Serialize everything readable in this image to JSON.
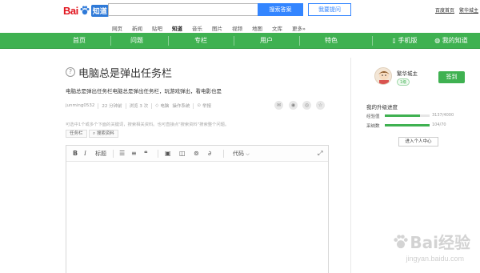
{
  "header": {
    "logo": {
      "bai": "Bai",
      "zhidao": "知道"
    },
    "search_placeholder": "",
    "search_button": "搜索答案",
    "ask_button": "我要提问",
    "top_links": [
      "百度首页",
      "繁华城主"
    ]
  },
  "category_nav": [
    "网页",
    "新闻",
    "贴吧",
    "知道",
    "音乐",
    "图片",
    "视频",
    "地图",
    "文库",
    "更多»"
  ],
  "category_active": "知道",
  "green_nav": [
    "首页",
    "问题",
    "专栏",
    "用户",
    "特色",
    "手机版",
    "我的知道"
  ],
  "question": {
    "title": "电脑总是弹出任务栏",
    "description": "电脑总是弹出任务栏电脑总是弹出任务栏，玩游戏弹出，看电影也是",
    "meta": {
      "author": "junming0532",
      "time": "22 分钟前",
      "views": "浏览 3 次",
      "tags": [
        "电脑",
        "操作系统"
      ],
      "report": "举报"
    }
  },
  "answer": {
    "hint": "可选中1个或多个下面的关键词，搜索相关资料。也可直接点\"搜索资料\"搜索整个问题。",
    "keyword_chip": "任务栏",
    "search_material_button": "搜索资料",
    "toolbar": {
      "bold": "B",
      "italic": "I",
      "heading": "标题",
      "code": "代码"
    }
  },
  "sidebar": {
    "username": "繁华城主",
    "level": "1级",
    "sign_button": "签到",
    "upgrade_title": "我的升级进度",
    "progress": [
      {
        "label": "经验值",
        "value": "3137/4000",
        "fraction": 0.78
      },
      {
        "label": "采纳数",
        "value": "104/70",
        "fraction": 1.0
      }
    ],
    "personal_center_button": "进入个人中心"
  },
  "watermark": {
    "text": "Bai经验",
    "url": "jingyan.baidu.com"
  },
  "colors": {
    "green": "#3fb151",
    "blue": "#3385ff",
    "red": "#e1141e"
  }
}
